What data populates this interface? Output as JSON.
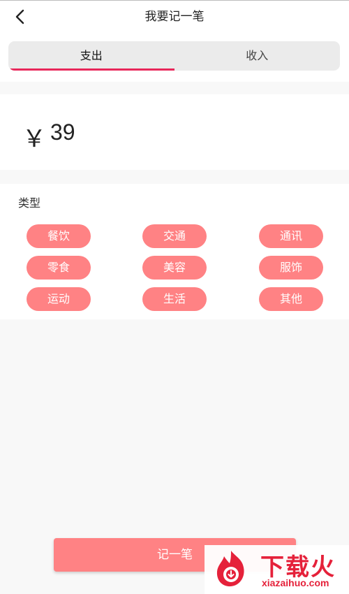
{
  "header": {
    "title": "我要记一笔",
    "back_icon": "chevron-left-icon"
  },
  "tabs": [
    {
      "label": "支出",
      "active": true
    },
    {
      "label": "收入",
      "active": false
    }
  ],
  "amount": {
    "currency": "￥",
    "value": "39"
  },
  "types": {
    "label": "类型",
    "items": [
      "餐饮",
      "交通",
      "通讯",
      "零食",
      "美容",
      "服饰",
      "运动",
      "生活",
      "其他"
    ]
  },
  "submit": {
    "label": "记一笔"
  },
  "watermark": {
    "brand": "下载火",
    "domain": "xiazaihuo.com"
  },
  "colors": {
    "accent": "#e8275a",
    "chip": "#ff8284",
    "button": "#ff8284",
    "background": "#f8f8f8",
    "watermark": "#e5213a"
  }
}
